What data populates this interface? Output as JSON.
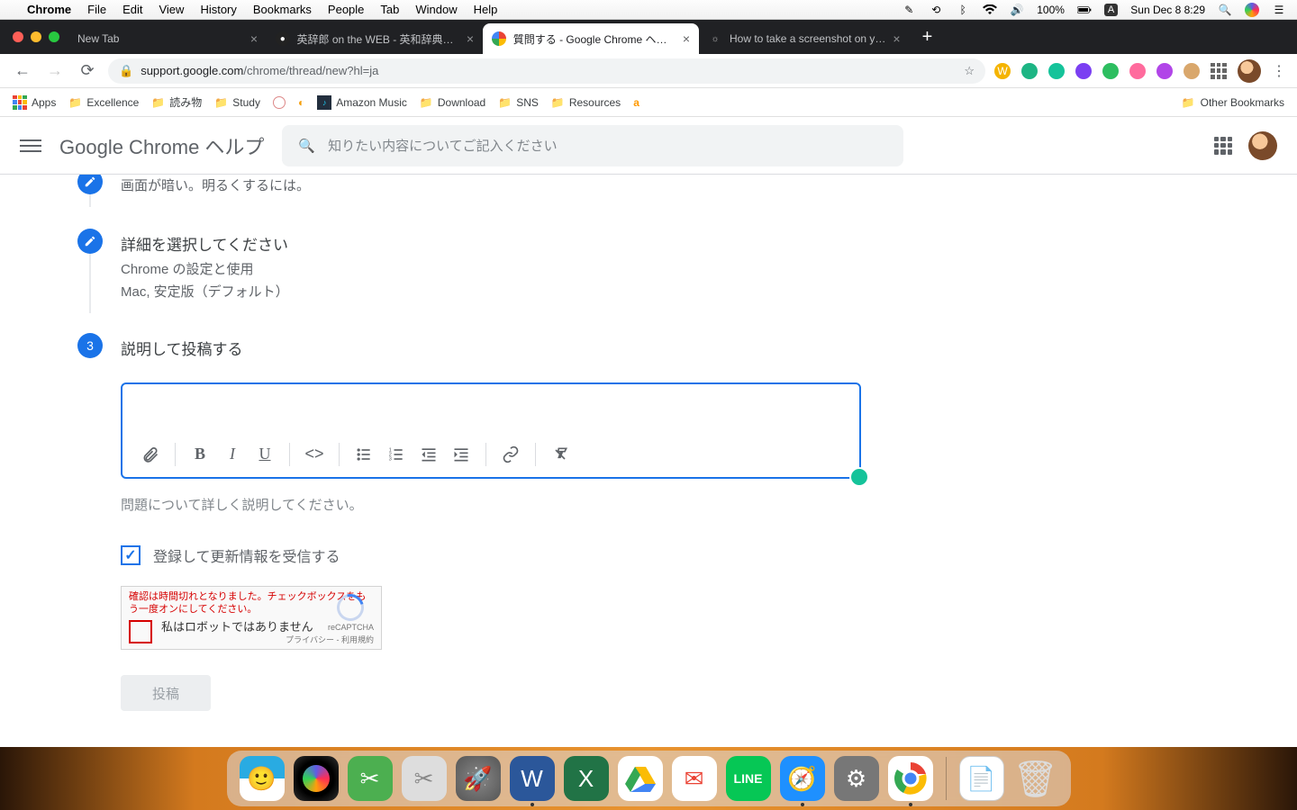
{
  "menubar": {
    "app": "Chrome",
    "items": [
      "File",
      "Edit",
      "View",
      "History",
      "Bookmarks",
      "People",
      "Tab",
      "Window",
      "Help"
    ],
    "battery": "100%",
    "input_indicator": "A",
    "clock": "Sun Dec 8  8:29"
  },
  "tabs": [
    {
      "title": "New Tab",
      "active": false
    },
    {
      "title": "英辞郎 on the WEB - 英和辞典・…",
      "active": false
    },
    {
      "title": "質問する - Google Chrome ヘル…",
      "active": true
    },
    {
      "title": "How to take a screenshot on y…",
      "active": false
    }
  ],
  "url": {
    "host": "support.google.com",
    "path": "/chrome/thread/new?hl=ja"
  },
  "bookmarks": [
    "Apps",
    "Excellence",
    "読み物",
    "Study",
    "Amazon Music",
    "Download",
    "SNS",
    "Resources"
  ],
  "other_bookmarks": "Other Bookmarks",
  "page": {
    "title": "Google Chrome ヘルプ",
    "search_placeholder": "知りたい内容についてご記入ください"
  },
  "steps": {
    "s1_sub": "画面が暗い。明るくするには。",
    "s2_title": "詳細を選択してください",
    "s2_line1": "Chrome の設定と使用",
    "s2_line2": "Mac, 安定版（デフォルト）",
    "s3_title": "説明して投稿する",
    "s3_num": "3"
  },
  "helper": "問題について詳しく説明してください。",
  "subscribe": "登録して更新情報を受信する",
  "recaptcha": {
    "error": "確認は時間切れとなりました。チェックボックスをもう一度オンにしてください。",
    "label": "私はロボットではありません",
    "brand": "reCAPTCHA",
    "links": "プライバシー - 利用規約"
  },
  "post": "投稿"
}
